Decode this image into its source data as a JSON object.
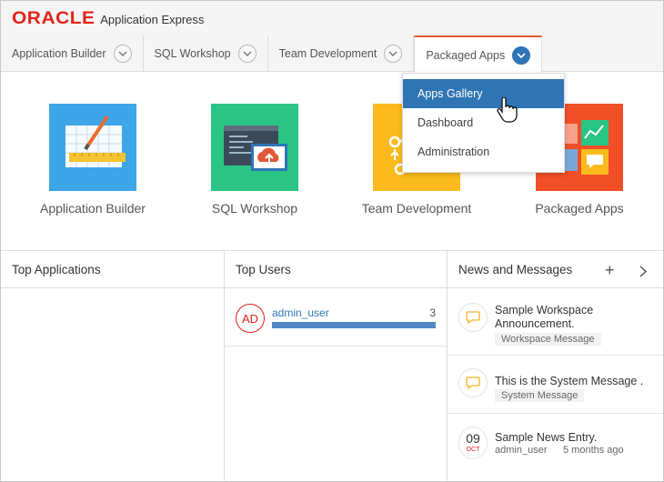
{
  "header": {
    "brand_oracle": "ORACLE",
    "brand_product": "Application Express"
  },
  "nav": {
    "items": [
      {
        "label": "Application Builder"
      },
      {
        "label": "SQL Workshop"
      },
      {
        "label": "Team Development"
      },
      {
        "label": "Packaged Apps"
      }
    ],
    "active_index": 3
  },
  "dropdown": {
    "items": [
      {
        "label": "Apps Gallery"
      },
      {
        "label": "Dashboard"
      },
      {
        "label": "Administration"
      }
    ],
    "selected_index": 0
  },
  "tiles": [
    {
      "label": "Application Builder",
      "color": "#3ea6e8"
    },
    {
      "label": "SQL Workshop",
      "color": "#2ac585"
    },
    {
      "label": "Team Development",
      "color": "#fbbb1c"
    },
    {
      "label": "Packaged Apps",
      "color": "#f04f28"
    }
  ],
  "panels": {
    "top_applications": {
      "title": "Top Applications"
    },
    "top_users": {
      "title": "Top Users",
      "rows": [
        {
          "initials": "AD",
          "name": "admin_user",
          "count": "3",
          "fill": 1.0
        }
      ]
    },
    "news": {
      "title": "News and Messages",
      "add_icon": "plus-icon",
      "next_icon": "chevron-right-icon",
      "items": [
        {
          "title_line1": "Sample Workspace",
          "title_line2": "Announcement.",
          "tag": "Workspace Message",
          "icon": "speech-bubble-icon"
        },
        {
          "title_line1": "This is the System Message .",
          "tag": "System Message",
          "icon": "speech-bubble-icon"
        },
        {
          "title_line1": "Sample News Entry.",
          "date_day": "09",
          "date_month": "OCT",
          "author": "admin_user",
          "age": "5 months ago"
        }
      ]
    }
  },
  "colors": {
    "oracle_red": "#e2231a",
    "accent_blue": "#2f75b5",
    "active_tab_border": "#e65933",
    "bubble_yellow": "#f5b523"
  }
}
